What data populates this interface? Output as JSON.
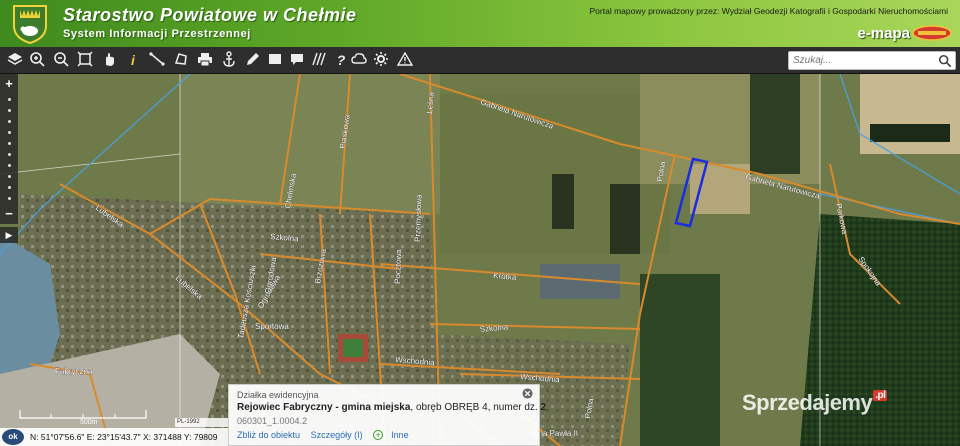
{
  "header": {
    "title": "Starostwo Powiatowe w Chełmie",
    "subtitle": "System Informacji Przestrzennej",
    "portal_info": "Portal mapowy prowadzony przez: Wydział  Geodezji Katografii i Gospodarki Nieruchomościami",
    "emapa_label": "e-mapa",
    "accent_color": "#5fa827"
  },
  "search": {
    "placeholder": "Szukaj..."
  },
  "toolbar": {
    "tools": [
      "layers-icon",
      "zoom-in-icon",
      "zoom-out-icon",
      "full-extent-icon",
      "info-icon",
      "measure-distance-icon",
      "measure-area-icon",
      "print-icon",
      "anchor-icon",
      "edit-icon",
      "draw-icon",
      "comment-icon",
      "hatch-icon",
      "help-icon",
      "cloud-icon",
      "settings-icon",
      "warning-icon"
    ]
  },
  "map": {
    "road_labels": [
      "Gabriela Narutowicza",
      "Gabriela Narutowicza",
      "Lubelska",
      "Lubelska",
      "Krótka",
      "Wschodnia",
      "Wschodnia",
      "Szkolna",
      "Polna",
      "Polna",
      "Fabryczna",
      "Tadeusza Kościuszki",
      "Chełmska",
      "Ogrodowa",
      "Jana Pawła II",
      "Brzozowa",
      "Leśna",
      "Pocztowa",
      "Przemysłowa",
      "Piaskowa",
      "Szkolna",
      "Sportowa",
      "Ogrodowa",
      "Parkowa",
      "Spokojna"
    ]
  },
  "popup": {
    "type": "Działka ewidencyjna",
    "locality": "Rejowiec Fabryczny - gmina miejska",
    "details_prefix": ", obręb ",
    "obreb": "OBRĘB 4",
    "details_mid": ", numer dz. ",
    "parcel_number": "2",
    "parcel_id": "060301_1.0004.2",
    "link_zoom": "Zbliż do obiektu",
    "link_details": "Szczegóły (I)",
    "link_other": "Inne"
  },
  "statusbar": {
    "ok_label": "ok",
    "coordinates": "N: 51°07'56.6\" E: 23°15'43.7\"  X: 371488   Y: 79809"
  },
  "scale": {
    "label": "500m",
    "crs": "PL-1992"
  },
  "watermark": {
    "text": "Sprzedajemy",
    "suffix": ".pl"
  }
}
